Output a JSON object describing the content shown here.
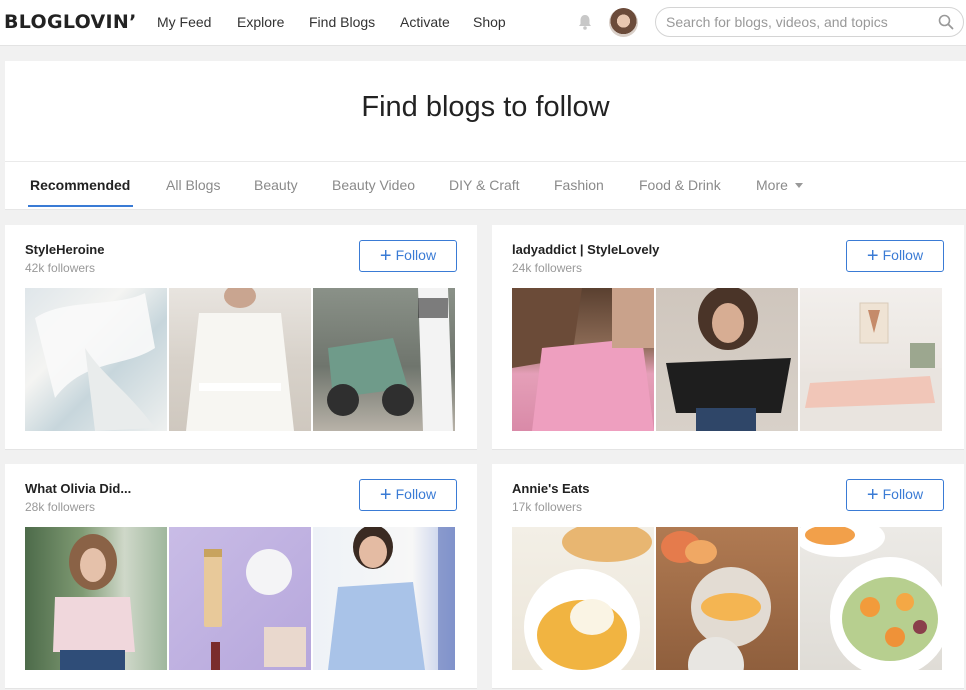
{
  "nav": {
    "logo": "BLOGLOVIN’",
    "items": [
      "My Feed",
      "Explore",
      "Find Blogs",
      "Activate",
      "Shop"
    ],
    "bell_icon": "bell-icon",
    "search_placeholder": "Search for blogs, videos, and topics",
    "search_value": ""
  },
  "page": {
    "title": "Find blogs to follow",
    "tabs": [
      "Recommended",
      "All Blogs",
      "Beauty",
      "Beauty Video",
      "DIY & Craft",
      "Fashion",
      "Food & Drink",
      "More"
    ],
    "active_tab": "Recommended"
  },
  "blogs": [
    {
      "name": "StyleHeroine",
      "followers": "42k followers",
      "follow_label": "Follow"
    },
    {
      "name": "ladyaddict | StyleLovely",
      "followers": "24k followers",
      "follow_label": "Follow"
    },
    {
      "name": "What Olivia Did...",
      "followers": "28k followers",
      "follow_label": "Follow"
    },
    {
      "name": "Annie's Eats",
      "followers": "17k followers",
      "follow_label": "Follow"
    }
  ],
  "colors": {
    "accent": "#3a7bd5",
    "background": "#f1f1f1"
  }
}
